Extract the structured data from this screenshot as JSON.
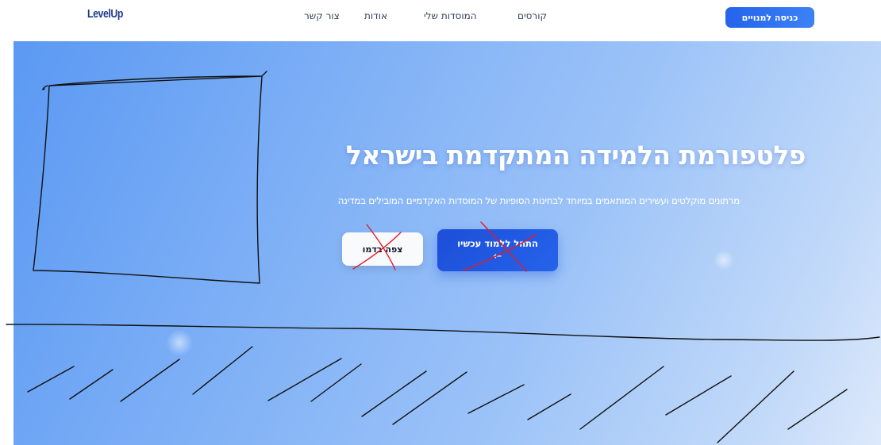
{
  "brand": {
    "logo": "LevelUp"
  },
  "nav": {
    "courses": "קורסים",
    "my_institutions": "המוסדות שלי",
    "about": "אודות",
    "contact": "צור קשר",
    "subscribe": "כניסה למנויים"
  },
  "hero": {
    "title": "פלטפורמת הלמידה המתקדמת בישראל",
    "subtitle": "מרתונים מוקלטים ועשירים המותאמים במיוחד לבחינות הסופיות של המוסדות האקדמיים המובילים במדינה",
    "primary_button": "התחל ללמוד עכשיו",
    "primary_button_icon": "←",
    "secondary_button": "צפה בדמו"
  },
  "colors": {
    "accent": "#2563eb",
    "primary_button": "#1d4ed8",
    "hero_start": "#5b99f3",
    "hero_end": "#dde9fb",
    "sketch_black": "#111111",
    "sketch_red": "#e11d2a"
  }
}
